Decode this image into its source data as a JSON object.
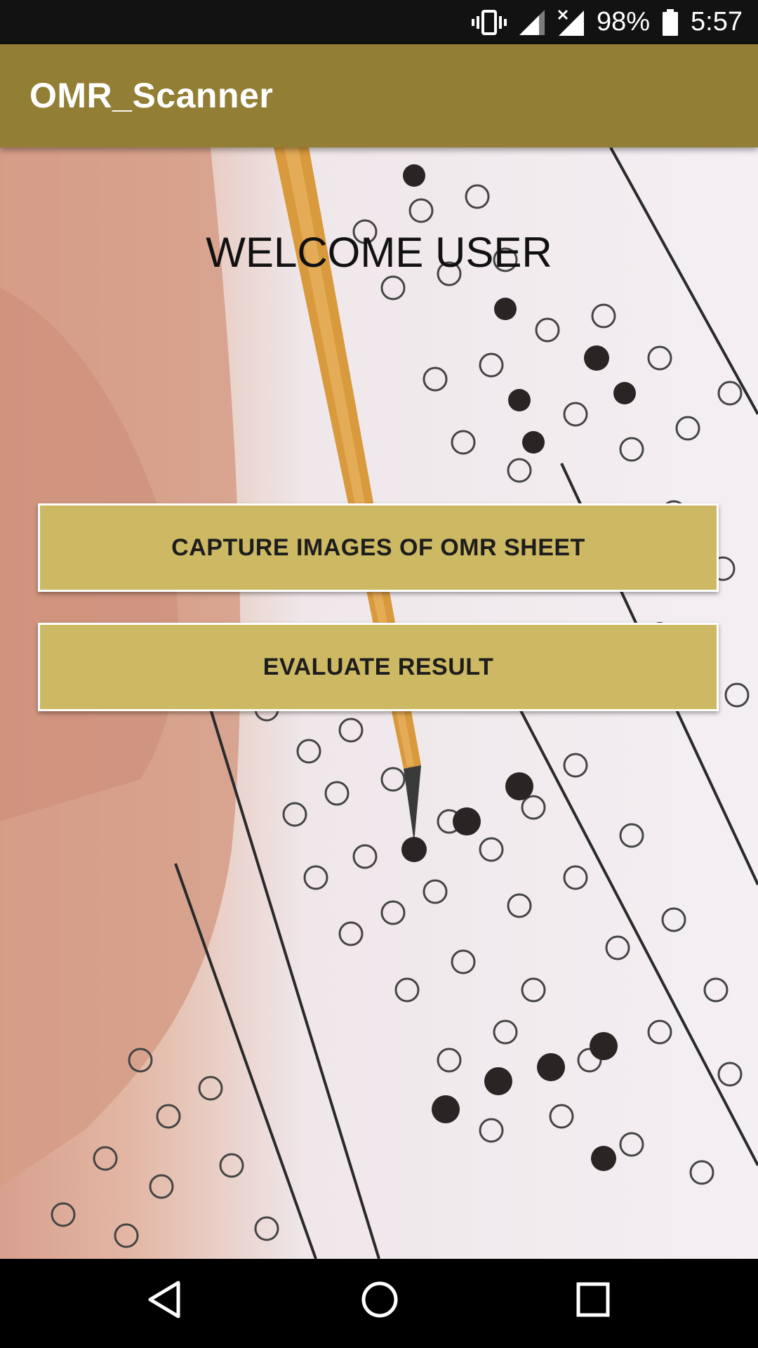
{
  "status_bar": {
    "battery_percent": "98%",
    "time": "5:57",
    "icons": [
      "vibrate-icon",
      "signal-icon",
      "no-data-signal-icon",
      "battery-icon"
    ]
  },
  "app_bar": {
    "title": "OMR_Scanner",
    "color": "#937e35"
  },
  "main": {
    "welcome": "WELCOME USER",
    "buttons": [
      {
        "label": "CAPTURE IMAGES OF OMR SHEET"
      },
      {
        "label": "EVALUATE RESULT"
      }
    ],
    "button_color": "#cdb963"
  },
  "nav_bar": {
    "icons": [
      "back-icon",
      "home-icon",
      "recents-icon"
    ]
  }
}
